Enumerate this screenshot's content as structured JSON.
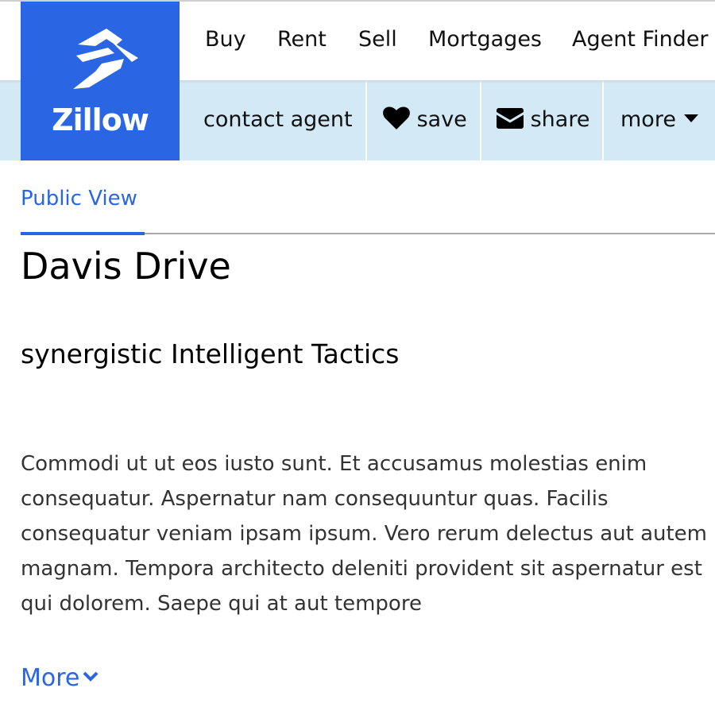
{
  "brand": {
    "name": "Zillow",
    "color": "#2a65e4",
    "logo_icon": "zillow-house-z-icon"
  },
  "nav": {
    "items": [
      {
        "label": "Buy"
      },
      {
        "label": "Rent"
      },
      {
        "label": "Sell"
      },
      {
        "label": "Mortgages"
      },
      {
        "label": "Agent Finder"
      }
    ]
  },
  "actions": {
    "background": "#d3e9f6",
    "contact_label": "contact agent",
    "save_label": "save",
    "save_icon": "heart-icon",
    "share_label": "share",
    "share_icon": "envelope-icon",
    "more_label": "more",
    "more_icon": "caret-down-icon"
  },
  "tabs": {
    "active_label": "Public View"
  },
  "listing": {
    "title": "Davis Drive",
    "subtitle": "synergistic Intelligent Tactics",
    "description": "Commodi ut ut eos iusto sunt. Et accusamus molestias enim consequatur. Aspernatur nam consequuntur quas. Facilis consequatur veniam ipsam ipsum. Vero rerum delectus aut autem magnam. Tempora architecto deleniti provident sit aspernatur est qui dolorem. Saepe qui at aut tempore",
    "more_label": "More",
    "more_icon": "chevron-down-icon"
  }
}
